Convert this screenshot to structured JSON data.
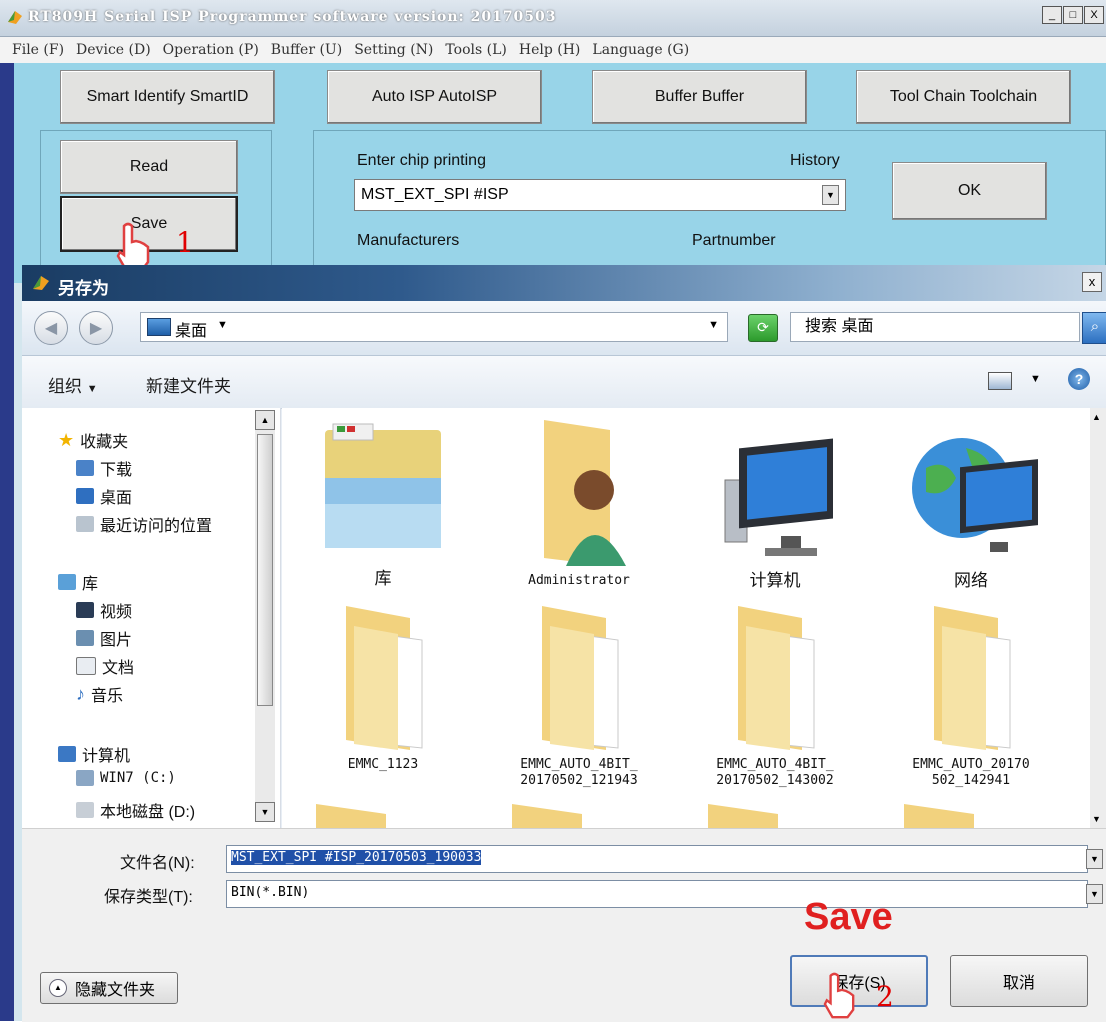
{
  "app": {
    "title": "RT809H Serial ISP Programmer software version: 20170503",
    "window_buttons": [
      "_",
      "□",
      "X"
    ],
    "menu": [
      "File (F)",
      "Device (D)",
      "Operation (P)",
      "Buffer (U)",
      "Setting (N)",
      "Tools (L)",
      "Help (H)",
      "Language (G)"
    ],
    "top_buttons": [
      "Smart Identify SmartID",
      "Auto ISP AutoISP",
      "Buffer Buffer",
      "Tool Chain Toolchain"
    ],
    "side_buttons": [
      "Read",
      "Save"
    ],
    "chip_label": "Enter chip printing",
    "history_label": "History",
    "chip_value": "MST_EXT_SPI #ISP",
    "ok_label": "OK",
    "manufacturers_label": "Manufacturers",
    "partnumber_label": "Partnumber",
    "annotation_1": "1"
  },
  "dialog": {
    "title": "另存为",
    "close": "x",
    "address": "桌面",
    "search_placeholder": "搜索 桌面",
    "organize": "组织",
    "new_folder": "新建文件夹",
    "nav": {
      "favorites": "收藏夹",
      "favorites_items": [
        "下载",
        "桌面",
        "最近访问的位置"
      ],
      "libraries": "库",
      "library_items": [
        "视频",
        "图片",
        "文档",
        "音乐"
      ],
      "computer": "计算机",
      "computer_items": [
        "WIN7 (C:)",
        "本地磁盘 (D:)"
      ]
    },
    "files": [
      {
        "label": "库",
        "icon": "library-folder-icon"
      },
      {
        "label": "Administrator",
        "icon": "user-folder-icon"
      },
      {
        "label": "计算机",
        "icon": "computer-icon"
      },
      {
        "label": "网络",
        "icon": "network-icon"
      },
      {
        "label": "EMMC_1123",
        "icon": "folder-icon"
      },
      {
        "label": "EMMC_AUTO_4BIT_\n20170502_121943",
        "icon": "folder-icon"
      },
      {
        "label": "EMMC_AUTO_4BIT_\n20170502_143002",
        "icon": "folder-icon"
      },
      {
        "label": "EMMC_AUTO_20170\n502_142941",
        "icon": "folder-icon"
      }
    ],
    "filename_label": "文件名(N):",
    "filename_value": "MST_EXT_SPI #ISP_20170503_190033",
    "filetype_label": "保存类型(T):",
    "filetype_value": "BIN(*.BIN)",
    "hide_folders": "隐藏文件夹",
    "save_button": "保存(S)",
    "cancel_button": "取消",
    "save_annotation": "Save",
    "annotation_2": "2"
  },
  "colors": {
    "annotation": "#e02020",
    "app_bg": "#98d4e8",
    "dialog_title": "#1a3c63"
  }
}
